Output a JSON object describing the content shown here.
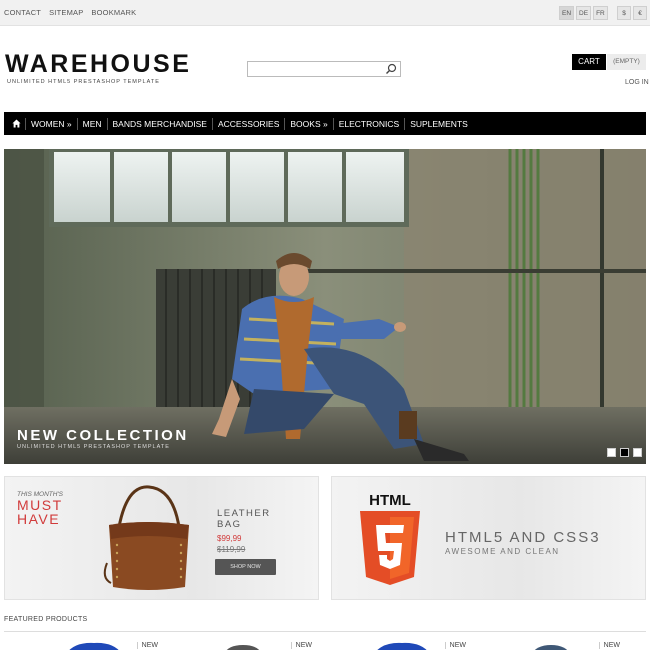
{
  "topbar": {
    "links": [
      "CONTACT",
      "SITEMAP",
      "BOOKMARK"
    ],
    "languages": [
      "EN",
      "DE",
      "FR"
    ],
    "currencies": [
      "$",
      "€"
    ]
  },
  "header": {
    "logo": "WAREHOUSE",
    "tagline": "UNLIMITED HTML5 PRESTASHOP TEMPLATE",
    "search_placeholder": "",
    "cart_label": "CART",
    "cart_status": "(EMPTY)",
    "login_label": "LOG IN"
  },
  "nav": {
    "items": [
      "WOMEN »",
      "MEN",
      "BANDS MERCHANDISE",
      "ACCESSORIES",
      "BOOKS »",
      "ELECTRONICS",
      "SUPLEMENTS"
    ]
  },
  "hero": {
    "title": "NEW COLLECTION",
    "subtitle": "UNLIMITED HTML5 PRESTASHOP TEMPLATE"
  },
  "banner_bag": {
    "kicker": "THIS MONTH'S",
    "headline": "MUST HAVE",
    "product": "LEATHER BAG",
    "price": "$99,99",
    "old_price": "$119,99",
    "button": "SHOP NOW"
  },
  "banner_html5": {
    "badge": "HTML",
    "badge_number": "5",
    "title": "HTML5 AND CSS3",
    "subtitle": "AWESOME AND CLEAN"
  },
  "featured": {
    "title": "FEATURED PRODUCTS",
    "products": [
      {
        "badge": "NEW"
      },
      {
        "badge": "NEW"
      },
      {
        "badge": "NEW"
      },
      {
        "badge": "NEW"
      }
    ]
  },
  "colors": {
    "accent_red": "#d13b3b",
    "nav_bg": "#000000",
    "html5_orange": "#e44d26"
  }
}
